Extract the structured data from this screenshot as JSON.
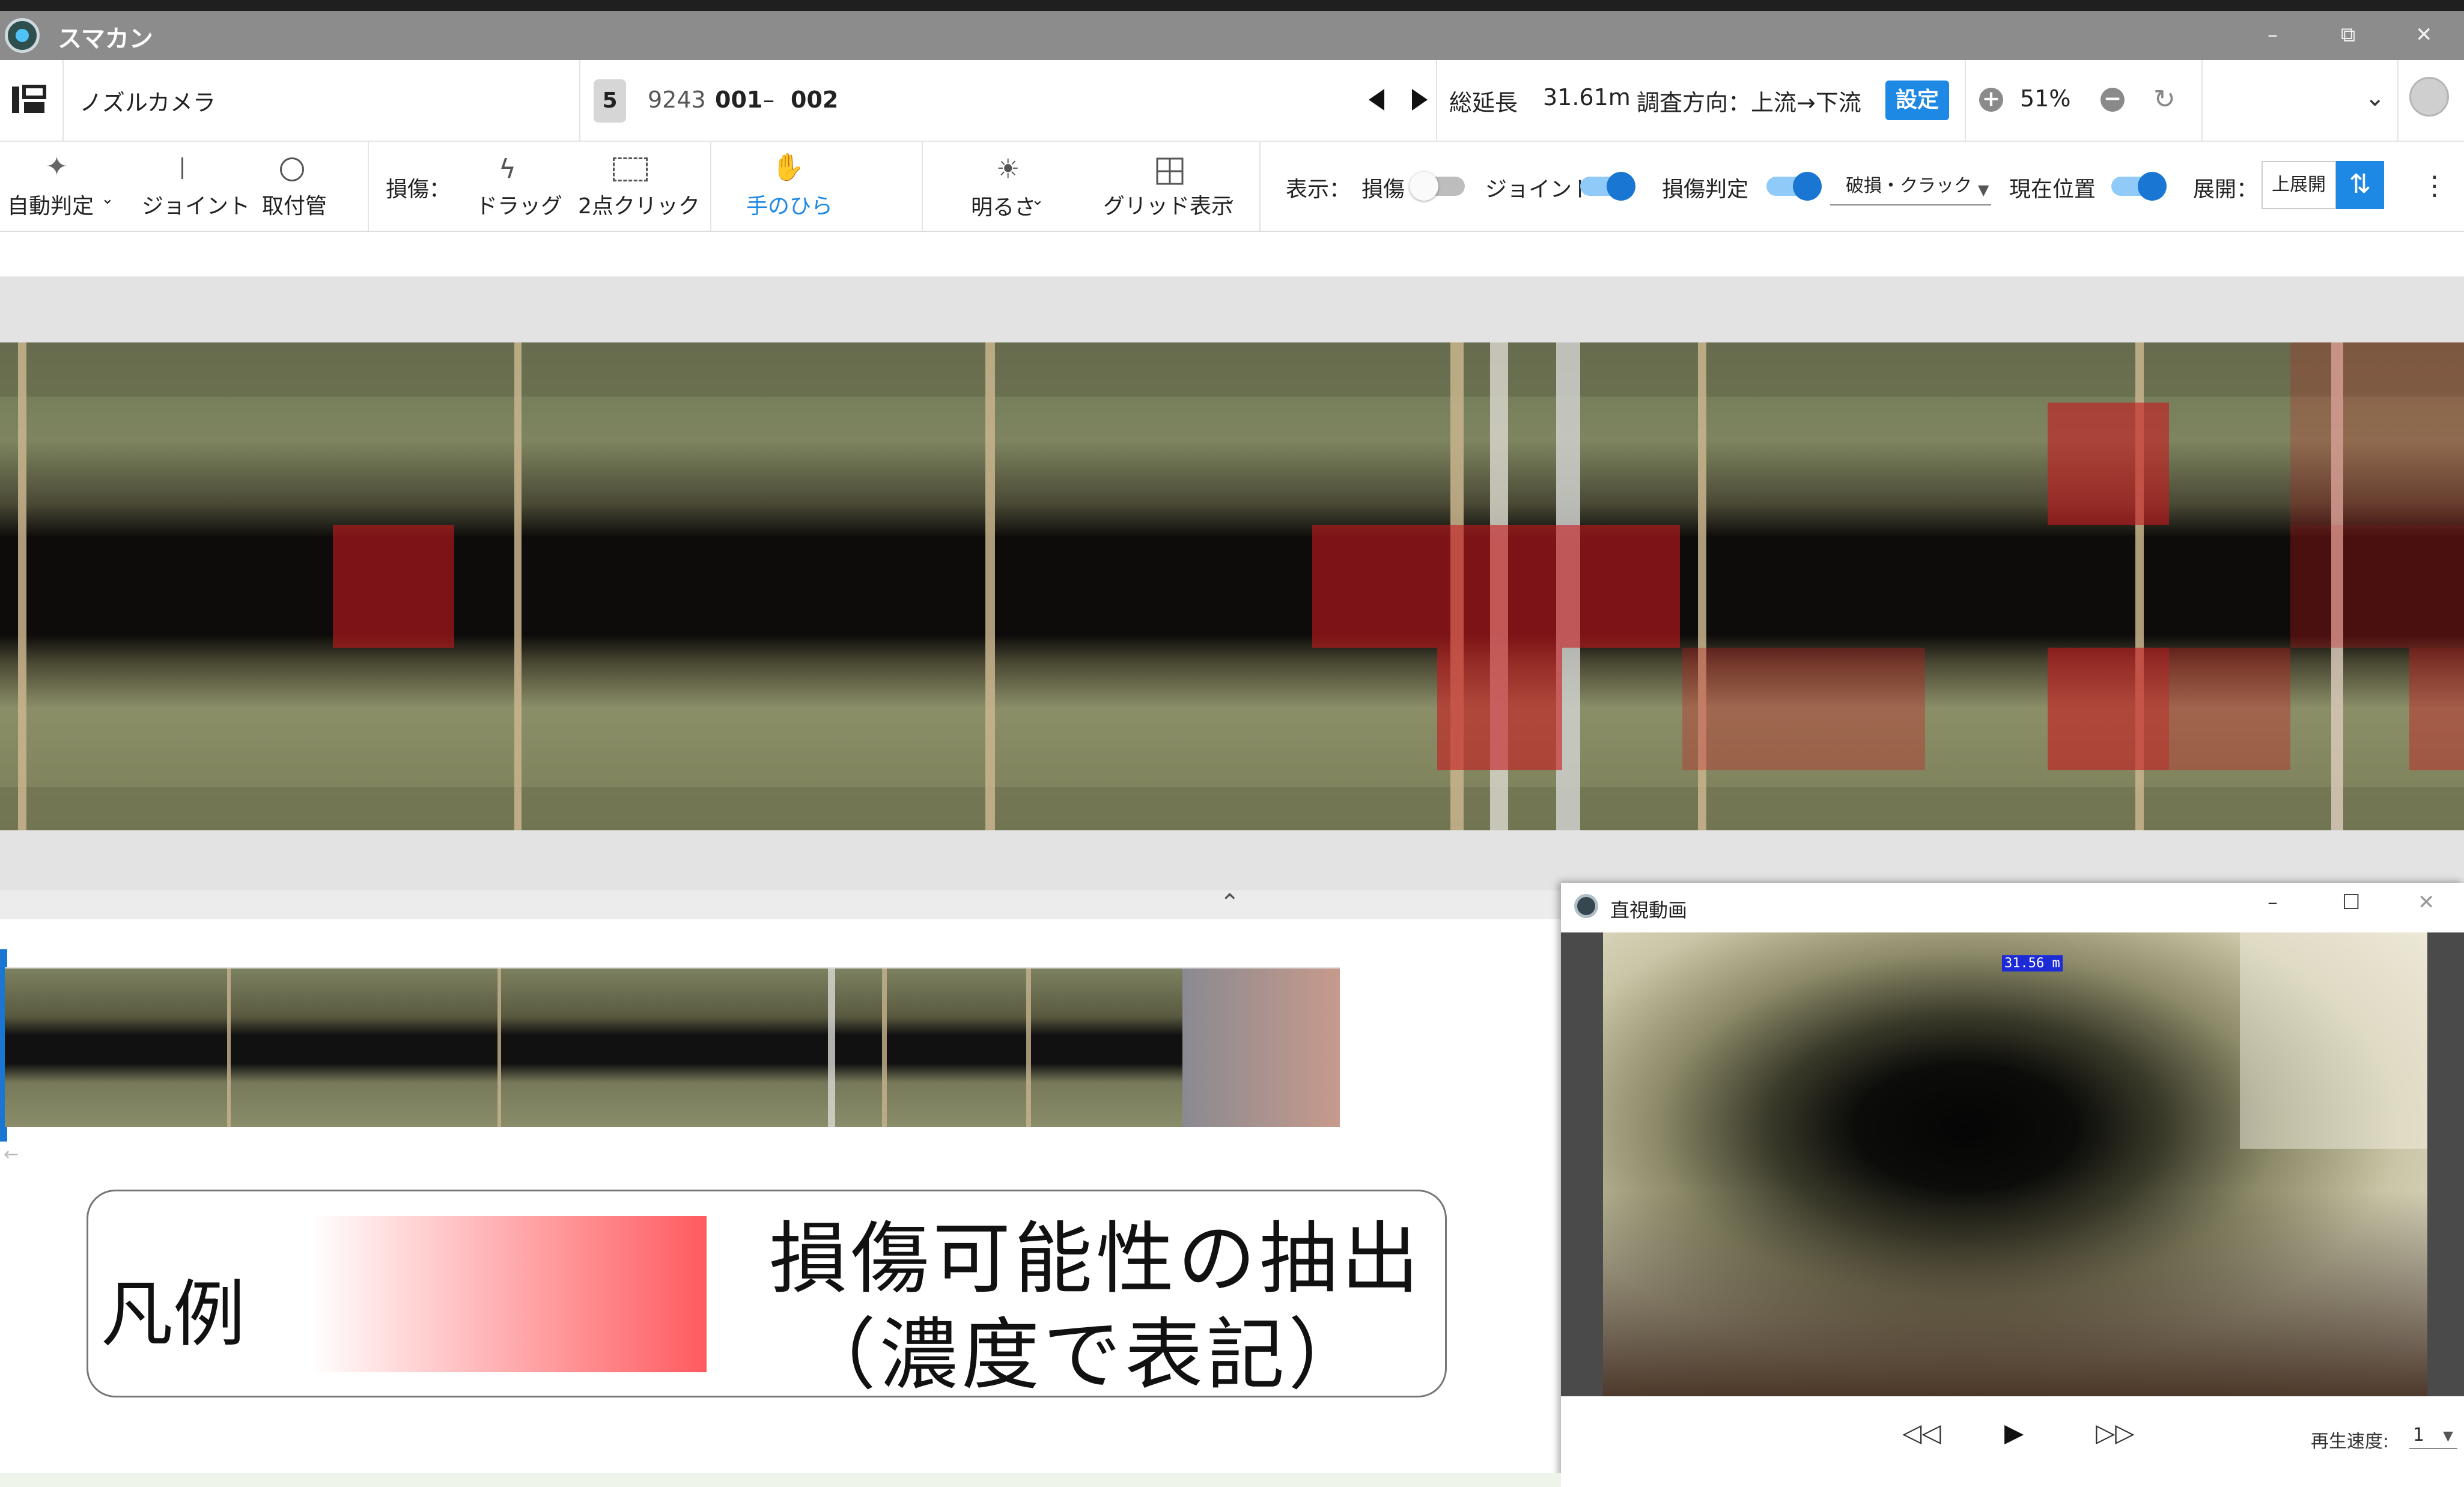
{
  "app": {
    "title": "スマカン",
    "window_controls": {
      "minimize": "–",
      "restore": "⧉",
      "close": "✕"
    }
  },
  "header": {
    "camera_label": "ノズルカメラ",
    "survey_badge": "5",
    "survey_id": "9243",
    "span_from": "001",
    "span_dash": "–",
    "span_to": "002",
    "total_length_label": "総延長",
    "total_length_value": "31.61m",
    "direction_label": "調査方向：上流→下流",
    "settings_button": "設定",
    "zoom_value": "51%"
  },
  "toolbar": {
    "auto_detect": "自動判定",
    "joint": "ジョイント",
    "fitting_pipe": "取付管",
    "damage_label": "損傷：",
    "drag": "ドラッグ",
    "two_point_click": "2点クリック",
    "hand": "手のひら",
    "brightness": "明るさ",
    "grid_display": "グリッド表示",
    "display_label": "表示：",
    "toggle_damage": {
      "label": "損傷",
      "on": false
    },
    "toggle_joint": {
      "label": "ジョイント",
      "on": true
    },
    "toggle_damage_judge": {
      "label": "損傷判定",
      "on": true
    },
    "damage_type_select": "破損・クラック",
    "toggle_current_position": {
      "label": "現在位置",
      "on": true
    },
    "expand_label": "展開：",
    "expand_value": "上展開"
  },
  "legend": {
    "title": "凡例",
    "line1": "損傷可能性の抽出",
    "line2": "（濃度で表記）",
    "gradient_from": "#ffffff",
    "gradient_to": "#ff5a5f"
  },
  "video_window": {
    "title": "直視動画",
    "distance_overlay": "31.56 m",
    "rewind": "◁◁",
    "play": "▶",
    "fast_forward": "▷▷",
    "speed_label": "再生速度:",
    "speed_value": "1"
  },
  "colors": {
    "accent": "#1e88e5",
    "damage_overlay": "#d7191e"
  }
}
